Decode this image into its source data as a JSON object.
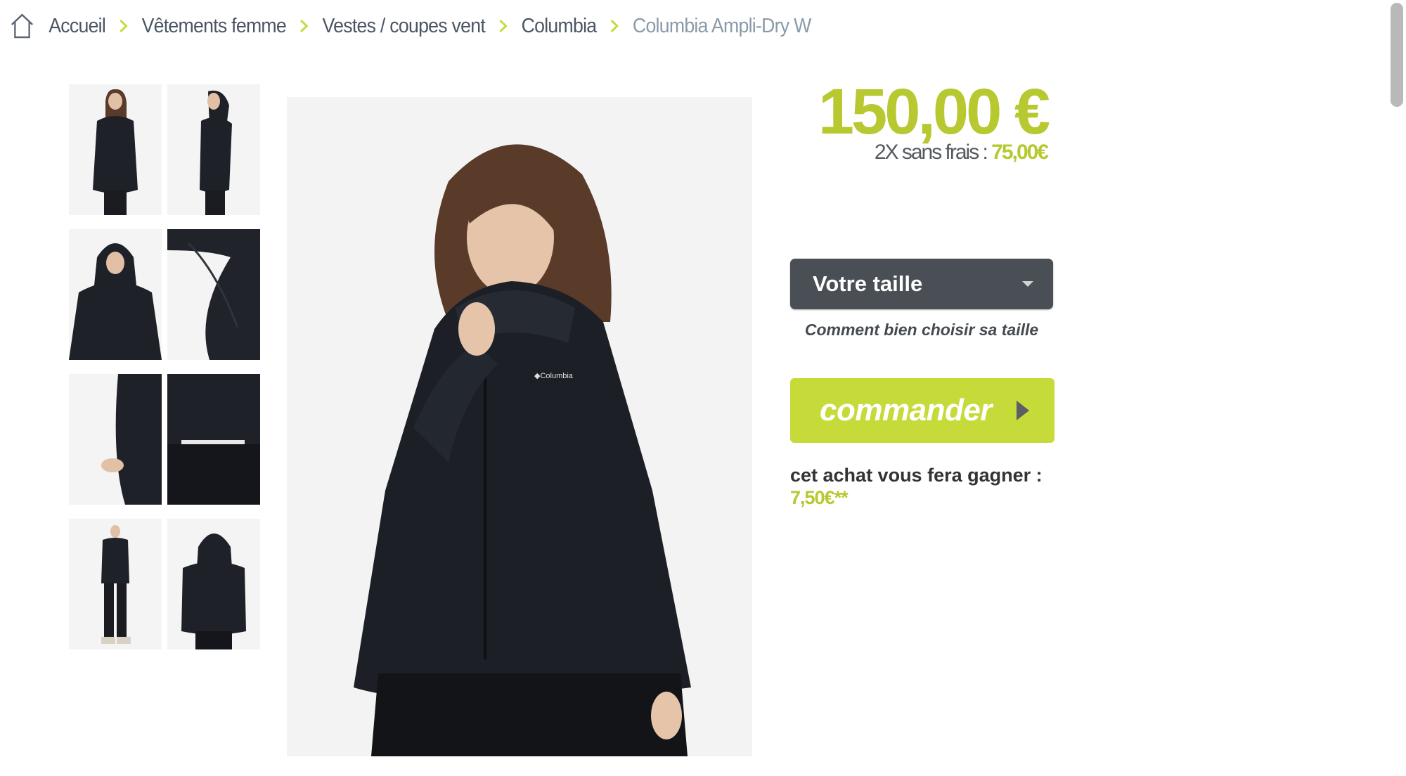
{
  "breadcrumb": {
    "items": [
      "Accueil",
      "Vêtements femme",
      "Vestes / coupes vent",
      "Columbia",
      "Columbia Ampli-Dry W"
    ]
  },
  "product": {
    "price": "150,00 €",
    "installments_text": "2X sans frais : ",
    "installments_amount": "75,00€",
    "size_select_label": "Votre taille",
    "size_guide_link": "Comment bien choisir sa taille",
    "order_button": "commander",
    "reward_text": "cet achat vous fera gagner :",
    "reward_amount": "7,50€**"
  },
  "colors": {
    "accent": "#c6da3a",
    "price": "#b7c830",
    "select_bg": "#4a4f55"
  },
  "icons": [
    "home-icon",
    "chevron-right-icon",
    "caret-down-icon",
    "play-arrow-icon"
  ]
}
